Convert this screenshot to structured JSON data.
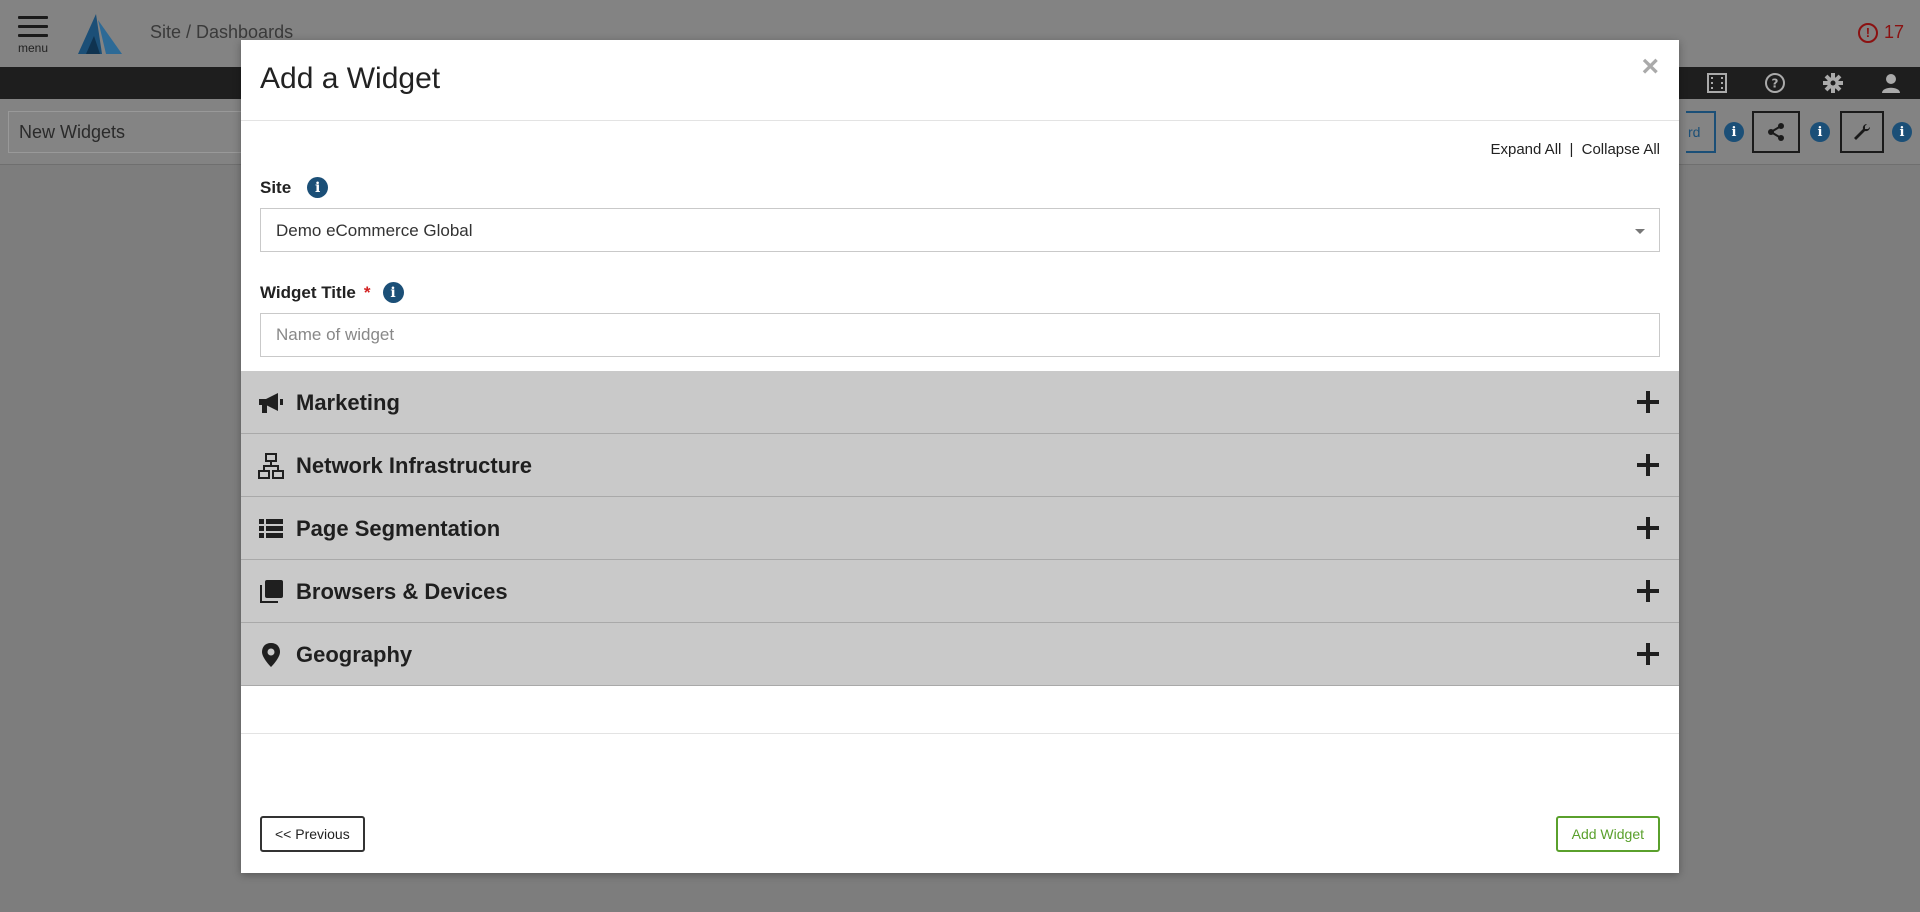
{
  "app": {
    "menu_label": "menu",
    "breadcrumb": "Site / Dashboards",
    "alert_count": "17",
    "dashboard_name": "New Widgets",
    "partial_button_text": "rd"
  },
  "modal": {
    "title": "Add a Widget",
    "close_symbol": "×",
    "expand_all": "Expand All",
    "separator": "|",
    "collapse_all": "Collapse All",
    "site_label": "Site",
    "site_value": "Demo eCommerce Global",
    "widget_title_label": "Widget Title",
    "required_mark": "*",
    "widget_title_placeholder": "Name of widget",
    "widget_title_value": "",
    "previous_button": "<< Previous",
    "add_widget_button": "Add Widget"
  },
  "categories": [
    {
      "label": "Marketing",
      "icon": "megaphone-icon"
    },
    {
      "label": "Network Infrastructure",
      "icon": "network-icon"
    },
    {
      "label": "Page Segmentation",
      "icon": "list-icon"
    },
    {
      "label": "Browsers & Devices",
      "icon": "clone-icon"
    },
    {
      "label": "Geography",
      "icon": "map-marker-icon"
    }
  ],
  "colors": {
    "accent_blue": "#1b4f77",
    "add_green": "#5aa02c",
    "alert_red": "#8b1111",
    "accordion_bg": "#c9c9c9"
  }
}
